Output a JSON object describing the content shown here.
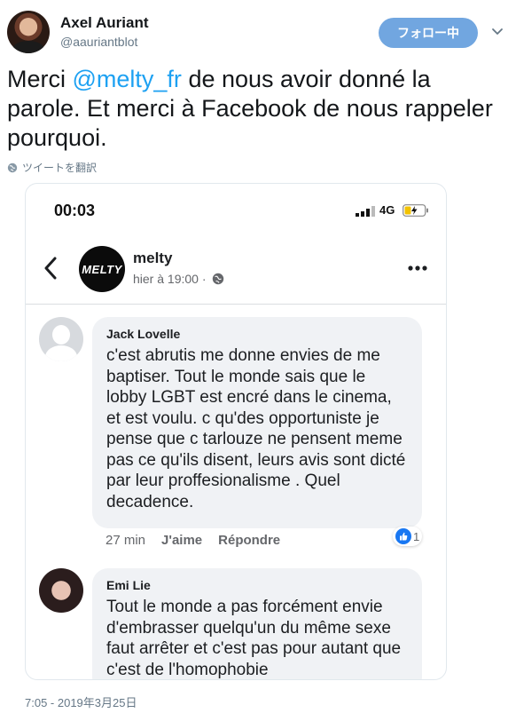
{
  "tweet": {
    "author_name": "Axel Auriant",
    "author_handle": "@aauriantblot",
    "follow_label": "フォロー中",
    "text_before": "Merci ",
    "mention": "@melty_fr",
    "text_after": " de nous avoir donné la parole. Et merci à Facebook de nous rappeler pourquoi.",
    "translate_label": "ツイートを翻訳",
    "date": "7:05 - 2019年3月25日",
    "colors": {
      "accent": "#1da1f2",
      "follow_button": "#71a6e0"
    }
  },
  "screenshot": {
    "status_time": "00:03",
    "network": "4G",
    "page_logo": "MELTY",
    "page_name": "melty",
    "post_time": "hier à 19:00 ·",
    "comments": [
      {
        "author": "Jack Lovelle",
        "text": "c'est abrutis me donne envies de me baptiser. Tout le monde sais que le lobby LGBT est encré dans le cinema, et est voulu. c qu'des opportuniste je pense que c tarlouze ne pensent meme pas ce qu'ils disent, leurs avis sont dicté par leur proffesionalisme . Quel decadence.",
        "time": "27 min",
        "like_label": "J'aime",
        "reply_label": "Répondre",
        "reaction_count": "1"
      },
      {
        "author": "Emi Lie",
        "text": "Tout le monde a pas forcément envie d'embrasser quelqu'un du même sexe faut arrêter et c'est pas pour autant que c'est de l'homophobie"
      }
    ]
  }
}
